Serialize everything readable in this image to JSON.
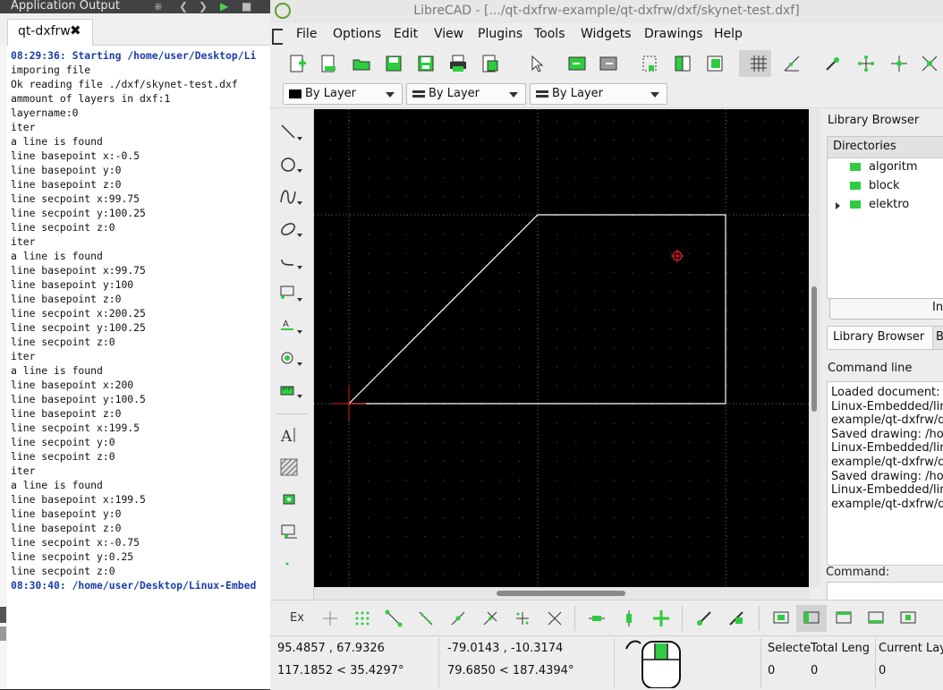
{
  "app_output": {
    "panel_title": "Application Output",
    "tab_label": "qt-dxfrw",
    "lines": [
      {
        "text": "08:29:36: Starting /home/user/Desktop/Li",
        "bold": true
      },
      {
        "text": "imporing file",
        "bold": false
      },
      {
        "text": "Ok reading file ./dxf/skynet-test.dxf",
        "bold": false
      },
      {
        "text": "ammount of layers in dxf:1",
        "bold": false
      },
      {
        "text": "layername:0",
        "bold": false
      },
      {
        "text": "iter",
        "bold": false
      },
      {
        "text": "a line is found",
        "bold": false
      },
      {
        "text": "line basepoint x:-0.5",
        "bold": false
      },
      {
        "text": "line basepoint y:0",
        "bold": false
      },
      {
        "text": "line basepoint z:0",
        "bold": false
      },
      {
        "text": "line secpoint x:99.75",
        "bold": false
      },
      {
        "text": "line secpoint y:100.25",
        "bold": false
      },
      {
        "text": "line secpoint z:0",
        "bold": false
      },
      {
        "text": "iter",
        "bold": false
      },
      {
        "text": "a line is found",
        "bold": false
      },
      {
        "text": "line basepoint x:99.75",
        "bold": false
      },
      {
        "text": "line basepoint y:100",
        "bold": false
      },
      {
        "text": "line basepoint z:0",
        "bold": false
      },
      {
        "text": "line secpoint x:200.25",
        "bold": false
      },
      {
        "text": "line secpoint y:100.25",
        "bold": false
      },
      {
        "text": "line secpoint z:0",
        "bold": false
      },
      {
        "text": "iter",
        "bold": false
      },
      {
        "text": "a line is found",
        "bold": false
      },
      {
        "text": "line basepoint x:200",
        "bold": false
      },
      {
        "text": "line basepoint y:100.5",
        "bold": false
      },
      {
        "text": "line basepoint z:0",
        "bold": false
      },
      {
        "text": "line secpoint x:199.5",
        "bold": false
      },
      {
        "text": "line secpoint y:0",
        "bold": false
      },
      {
        "text": "line secpoint z:0",
        "bold": false
      },
      {
        "text": "iter",
        "bold": false
      },
      {
        "text": "a line is found",
        "bold": false
      },
      {
        "text": "line basepoint x:199.5",
        "bold": false
      },
      {
        "text": "line basepoint y:0",
        "bold": false
      },
      {
        "text": "line basepoint z:0",
        "bold": false
      },
      {
        "text": "line secpoint x:-0.75",
        "bold": false
      },
      {
        "text": "line secpoint y:0.25",
        "bold": false
      },
      {
        "text": "line secpoint z:0",
        "bold": false
      },
      {
        "text": "08:30:40: /home/user/Desktop/Linux-Embed",
        "bold": true
      }
    ]
  },
  "librecad": {
    "window_title": "LibreCAD - [.../qt-dxfrw-example/qt-dxfrw/dxf/skynet-test.dxf]",
    "menu": [
      "File",
      "Options",
      "Edit",
      "View",
      "Plugins",
      "Tools",
      "Widgets",
      "Drawings",
      "Help"
    ],
    "attributes": {
      "color": "By Layer",
      "width": "By Layer",
      "linetype": "By Layer"
    },
    "library_browser": {
      "title": "Library Browser",
      "header": "Directories",
      "folders": [
        "algoritm",
        "block",
        "elektro"
      ],
      "button_label": "In",
      "tabs": [
        "Library Browser",
        "B"
      ]
    },
    "command_line": {
      "title": "Command line",
      "history": [
        "Loaded document:",
        "Linux-Embedded/lin",
        "example/qt-dxfrw/d",
        "Saved drawing: /ho",
        "Linux-Embedded/lin",
        "example/qt-dxfrw/d",
        "Saved drawing: /ho",
        "Linux-Embedded/lin",
        "example/qt-dxfrw/d"
      ],
      "prompt": "Command:"
    },
    "status": {
      "abs_coords": "95.4857 , 67.9326",
      "abs_polar": "117.1852 < 35.4297°",
      "rel_coords": "-79.0143 , -10.3174",
      "rel_polar": "79.6850 < 187.4394°",
      "selected_label": "Selecte",
      "selected_value": "0",
      "total_length_label": "Total Leng",
      "total_length_value": "0",
      "current_layer_label": "Current Laye",
      "current_layer_value": "0"
    },
    "snap_ex_label": "Ex",
    "colors": {
      "icon_green": "#2ecc40",
      "canvas_bg": "#000000",
      "drawing_line": "#ffffff",
      "crosshair": "#e02020"
    }
  }
}
